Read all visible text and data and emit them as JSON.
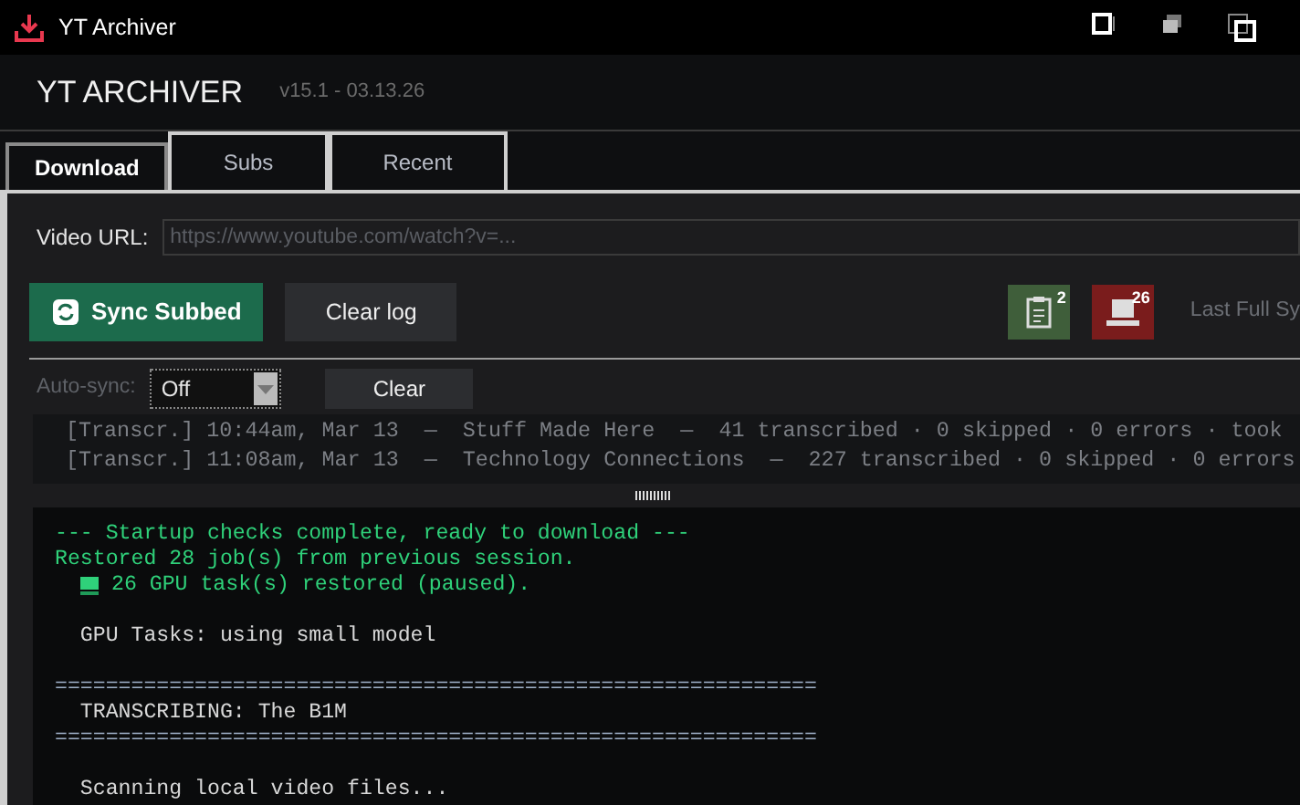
{
  "window": {
    "title": "YT Archiver"
  },
  "header": {
    "title": "YT ARCHIVER",
    "version": "v15.1 - 03.13.26"
  },
  "tabs": [
    {
      "label": "Download",
      "selected": true
    },
    {
      "label": "Subs",
      "selected": false
    },
    {
      "label": "Recent",
      "selected": false
    }
  ],
  "url_field": {
    "label": "Video URL:",
    "placeholder": "https://www.youtube.com/watch?v=..."
  },
  "buttons": [
    {
      "label": "Sync Subbed",
      "kind": "primary"
    },
    {
      "label": "Clear log",
      "kind": "secondary"
    }
  ],
  "queue_badges": [
    {
      "count": "2",
      "kind": "clipboard",
      "color": "#3f5e3a"
    },
    {
      "count": "26",
      "kind": "laptop",
      "color": "#7a1c1c"
    }
  ],
  "last_sync": "Last Full Sy",
  "auto_sync": {
    "label": "Auto-sync:",
    "value": "Off",
    "disabled": true
  },
  "clear_button": "Clear",
  "history": [
    "[Transcr.] 10:44am, Mar 13  —  Stuff Made Here  —  41 transcribed · 0 skipped · 0 errors · took",
    "[Transcr.] 11:08am, Mar 13  —  Technology Connections  —  227 transcribed · 0 skipped · 0 errors"
  ],
  "log": [
    {
      "kind": "status",
      "text": "--- Startup checks complete, ready to download ---"
    },
    {
      "kind": "status",
      "text": "Restored 28 job(s) from previous session."
    },
    {
      "kind": "gpu",
      "text": "26 GPU task(s) restored (paused)."
    },
    {
      "kind": "blank"
    },
    {
      "kind": "plain",
      "text": "  GPU Tasks: using small model"
    },
    {
      "kind": "blank"
    },
    {
      "kind": "rule",
      "text": "============================================================"
    },
    {
      "kind": "plain",
      "text": "  TRANSCRIBING: The B1M"
    },
    {
      "kind": "rule",
      "text": "============================================================"
    },
    {
      "kind": "blank"
    },
    {
      "kind": "plain",
      "text": "  Scanning local video files..."
    }
  ]
}
